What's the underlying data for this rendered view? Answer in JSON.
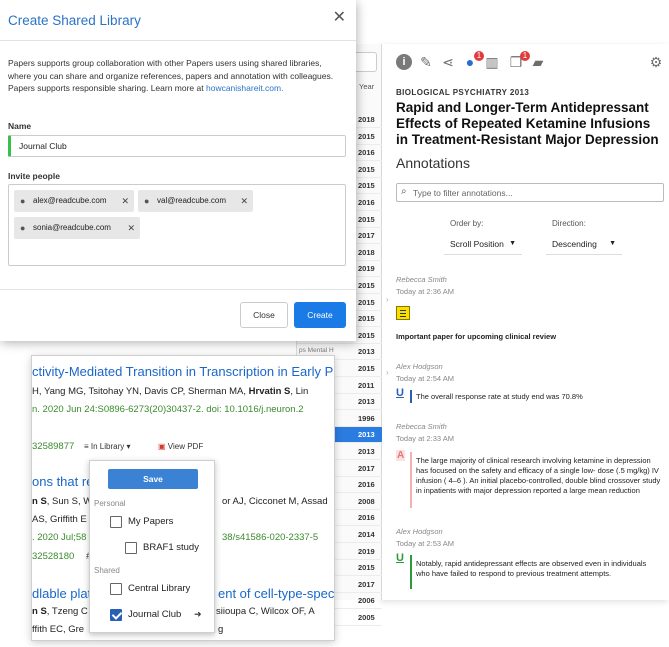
{
  "dialog": {
    "title": "Create Shared Library",
    "close_glyph": "✕",
    "description": "Papers supports group collaboration with other Papers users using shared libraries, where you can share and organize references, papers and annotation with colleagues. Papers supports responsible sharing. Learn more at",
    "link": "howcanishareit.com.",
    "name_label": "Name",
    "name_value": "Journal Club",
    "invite_label": "Invite people",
    "invitees": [
      "alex@readcube.com",
      "val@readcube.com",
      "sonia@readcube.com"
    ],
    "chip_remove": "✕",
    "close_button": "Close",
    "create_button": "Create"
  },
  "middle": {
    "year_header": "Year",
    "rows": [
      {
        "snippet": "",
        "year": "2018"
      },
      {
        "snippet": "",
        "year": "2015"
      },
      {
        "snippet": "",
        "year": "2016"
      },
      {
        "snippet": "",
        "year": "2015"
      },
      {
        "snippet": "",
        "year": "2015"
      },
      {
        "snippet": "",
        "year": "2016"
      },
      {
        "snippet": "",
        "year": "2015"
      },
      {
        "snippet": "",
        "year": "2017"
      },
      {
        "snippet": "",
        "year": "2018"
      },
      {
        "snippet": "",
        "year": "2019"
      },
      {
        "snippet": "",
        "year": "2015"
      },
      {
        "snippet": "",
        "year": "2015"
      },
      {
        "snippet": "",
        "year": "2015"
      },
      {
        "snippet": "",
        "year": "2015"
      },
      {
        "snippet": "ps Mental H",
        "year": "2013"
      },
      {
        "snippet": "aceutical S",
        "year": "2015"
      },
      {
        "snippet": "",
        "year": "2011"
      },
      {
        "snippet": "",
        "year": "2013"
      },
      {
        "snippet": "",
        "year": "1996"
      },
      {
        "snippet": "",
        "year": "2013"
      },
      {
        "snippet": "",
        "year": "2013"
      },
      {
        "snippet": "",
        "year": "2017"
      },
      {
        "snippet": "",
        "year": "2016"
      },
      {
        "snippet": "",
        "year": "2008"
      },
      {
        "snippet": "",
        "year": "2016"
      },
      {
        "snippet": "",
        "year": "2014"
      },
      {
        "snippet": "",
        "year": "2019"
      },
      {
        "snippet": "",
        "year": "2015"
      },
      {
        "snippet": "",
        "year": "2017"
      },
      {
        "snippet": "",
        "year": "2006"
      },
      {
        "snippet": "",
        "year": "2005"
      }
    ]
  },
  "annotations_panel": {
    "toolbar_icons": [
      "info-icon",
      "edit-icon",
      "share-icon",
      "comment-icon",
      "stats-icon",
      "copy-icon",
      "bag-icon",
      "gear-icon"
    ],
    "toolbar_badges": {
      "comment": "1",
      "copy": "1"
    },
    "journal": "BIOLOGICAL PSYCHIATRY 2013",
    "title": "Rapid and Longer-Term Antidepressant Effects of Repeated Ketamine Infusions in Treatment-Resistant Major Depression",
    "heading": "Annotations",
    "filter_placeholder": "Type to filter annotations...",
    "order_label": "Order by:",
    "order_value": "Scroll Position",
    "direction_label": "Direction:",
    "direction_value": "Descending",
    "items": [
      {
        "author": "Rebecca Smith",
        "time": "Today at 2:36 AM",
        "text": "Important paper for upcoming clinical review"
      },
      {
        "author": "Alex Hodgson",
        "time": "Today at 2:54 AM",
        "glyph": "U",
        "text": "The overall response rate at study end was 70.8%"
      },
      {
        "author": "Rebecca Smith",
        "time": "Today at 2:33 AM",
        "glyph": "A",
        "text": "The large majority of clinical research involving ketamine in depression has focused on the safety and efficacy of a single low- dose (.5 mg/kg) IV infusion ( 4–6 ). An initial placebo-controlled, double blind crossover study in inpatients with major depression reported a large mean reduction"
      },
      {
        "author": "Alex Hodgson",
        "time": "Today at 2:53 AM",
        "glyph": "U",
        "text": "Notably, rapid antidepressant effects are observed even in individuals who have failed to respond to previous treatment attempts."
      }
    ],
    "colors": {
      "underline_blue": "#2a5fb8",
      "underline_green": "#2e9a3c",
      "highlight_red": "#e77777",
      "note_yellow": "#f8e000"
    }
  },
  "results": {
    "r1_title": "ctivity-Mediated Transition in Transcription in Early P",
    "r1_authors_pre": "H, Yang MG, Tsitohay YN, Davis CP, Sherman MA, ",
    "r1_authors_bold": "Hrvatin S",
    "r1_authors_post": ", Lin",
    "r1_cite": "n. 2020 Jun 24:S0896-6273(20)30437-2. doi: 10.1016/j.neuron.2",
    "r1_id": "32589877",
    "in_library": "In Library",
    "view_pdf": "View PDF",
    "r2_title": "ons that re",
    "r2_authors_a": "n S",
    "r2_authors_b": ", Sun S, W",
    "r2_authors_c": "or AJ, Cicconet M, Assad",
    "r2_authors_d": "AS, Griffith E",
    "r2_cite_a": ". 2020 Jul;58",
    "r2_cite_b": "38/s41586-020-2337-5",
    "r2_id": "32528180",
    "r2_hash": "#",
    "r3_title_a": "dlable platf",
    "r3_title_b": "ent of cell-type-spec",
    "r3_authors_a": "n S",
    "r3_authors_b": ", Tzeng C",
    "r3_authors_c": "siioupa C, Wilcox OF, A",
    "r3_authors_d": "ffith EC, Gre",
    "r3_authors_e": "g"
  },
  "dropdown": {
    "save": "Save",
    "personal_label": "Personal",
    "shared_label": "Shared",
    "items": [
      {
        "label": "My Papers",
        "checked": false
      },
      {
        "label": "BRAF1 study",
        "checked": false
      },
      {
        "label": "Central Library",
        "checked": false
      },
      {
        "label": "Journal Club",
        "checked": true
      }
    ],
    "arrow": "➜"
  }
}
